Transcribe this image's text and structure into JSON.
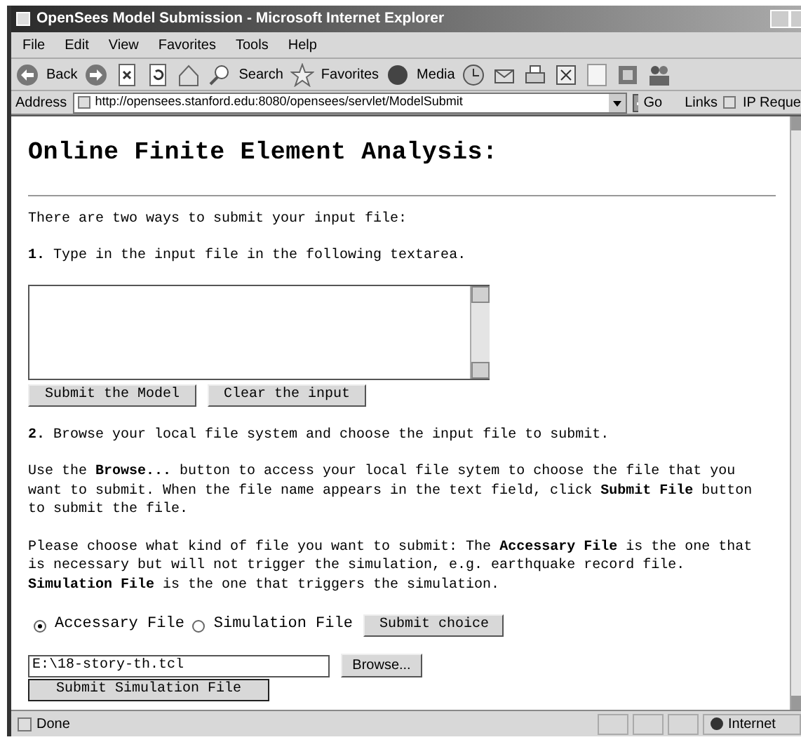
{
  "window": {
    "title": "OpenSees Model Submission - Microsoft Internet Explorer"
  },
  "menu": [
    "File",
    "Edit",
    "View",
    "Favorites",
    "Tools",
    "Help"
  ],
  "toolbar": [
    "Back",
    "Search",
    "Favorites",
    "Media"
  ],
  "address": {
    "label": "Address",
    "url": "http://opensees.stanford.edu:8080/opensees/servlet/ModelSubmit",
    "go": "Go",
    "links": "Links",
    "link_item": "IP Reque"
  },
  "page": {
    "heading": "Online Finite Element Analysis:",
    "intro": "There are two ways to submit your input file:",
    "step1": {
      "number": "1.",
      "text": "Type in the input file in the following textarea."
    },
    "form_buttons": [
      "Submit the Model",
      "Clear the input"
    ],
    "step2": {
      "number": "2.",
      "text": "Browse your local file system and choose the input file to submit."
    },
    "paragraphs": [
      "Use the **Browse...** button to access your local file sytem to choose the file that you want to submit. When the file name appears in the text field, click **Submit File** button to submit the file.",
      "Please choose what kind of file you want to submit: The **Accessary File** is the one that is necessary but will not trigger the simulation, e.g. earthquake record file. **Simulation File** is the one that triggers the simulation."
    ],
    "radios": [
      {
        "label": "Accessary File",
        "selected": true
      },
      {
        "label": "Simulation File",
        "selected": false
      }
    ],
    "submit_choice": "Submit choice",
    "file_value": "E:\\18-story-th.tcl",
    "browse": "Browse...",
    "submit_file": "Submit Simulation File"
  },
  "status_bar": {
    "text": "Done",
    "zone": "Internet"
  }
}
